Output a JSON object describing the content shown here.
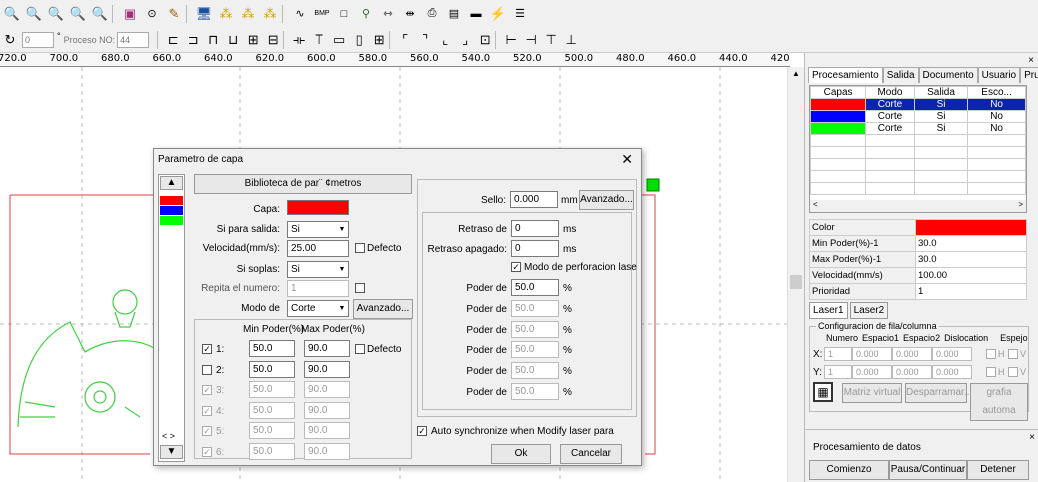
{
  "toolbar2": {
    "angle_value": "0",
    "degree_symbol": "°",
    "proceso_label": "Proceso NO:",
    "proceso_value": "44"
  },
  "ruler": {
    "ticks": [
      "720.0",
      "700.0",
      "680.0",
      "660.0",
      "640.0",
      "620.0",
      "600.0",
      "580.0",
      "560.0",
      "540.0",
      "520.0",
      "500.0",
      "480.0",
      "460.0",
      "440.0",
      "420.0"
    ]
  },
  "right_panel": {
    "tabs": [
      "Procesamiento",
      "Salida",
      "Documento",
      "Usuario",
      "Pru"
    ],
    "layer_headers": [
      "Capas",
      "Modo",
      "Salida",
      "Esco..."
    ],
    "layers": [
      {
        "color": "#ff0000",
        "mode": "Corte",
        "output": "Si",
        "skip": "No",
        "selected": true
      },
      {
        "color": "#0000ff",
        "mode": "Corte",
        "output": "Si",
        "skip": "No",
        "selected": false
      },
      {
        "color": "#00ff00",
        "mode": "Corte",
        "output": "Si",
        "skip": "No",
        "selected": false
      }
    ],
    "props": [
      {
        "label": "Color",
        "value": ""
      },
      {
        "label": "Min Poder(%)-1",
        "value": "30.0"
      },
      {
        "label": "Max Poder(%)-1",
        "value": "30.0"
      },
      {
        "label": "Velocidad(mm/s)",
        "value": "100.00"
      },
      {
        "label": "Prioridad",
        "value": "1"
      }
    ],
    "laser_tabs": [
      "Laser1",
      "Laser2"
    ],
    "grid_title": "Configuracion de fila/columna",
    "grid_headers": [
      "Numero",
      "Espacio1",
      "Espacio2",
      "Dislocation",
      "Espejo"
    ],
    "grid_x_label": "X:",
    "grid_y_label": "Y:",
    "grid_x": [
      "1",
      "0.000",
      "0.000",
      "0.000"
    ],
    "grid_y": [
      "1",
      "0.000",
      "0.000",
      "0.000"
    ],
    "mirror_h": "H",
    "mirror_v": "V",
    "matriz_btn": "Matriz virtual",
    "desparramar_btn": "Desparramar...",
    "grafia_btn": "grafia automa",
    "datos_title": "Procesamiento de datos",
    "comienzo_btn": "Comienzo",
    "pausa_btn": "Pausa/Continuar",
    "detener_btn": "Detener"
  },
  "dialog": {
    "title": "Parametro de capa",
    "library_btn": "Biblioteca de par¨ ¢metros",
    "capa_label": "Capa:",
    "capa_color": "#ff0000",
    "si_salida_label": "Si para salida:",
    "si_salida_value": "Si",
    "velocidad_label": "Velocidad(mm/s):",
    "velocidad_value": "25.00",
    "defecto_label": "Defecto",
    "soplas_label": "Si soplas:",
    "soplas_value": "Si",
    "repita_label": "Repita el numero:",
    "repita_value": "1",
    "modo_label": "Modo de",
    "modo_value": "Corte",
    "avanzado_btn": "Avanzado...",
    "min_poder_label": "Min Poder(%)",
    "max_poder_label": "Max Poder(%)",
    "power_rows": [
      {
        "n": "1:",
        "min": "50.0",
        "max": "90.0",
        "checked": true,
        "enabled": true
      },
      {
        "n": "2:",
        "min": "50.0",
        "max": "90.0",
        "checked": false,
        "enabled": true
      },
      {
        "n": "3:",
        "min": "50.0",
        "max": "90.0",
        "checked": true,
        "enabled": false
      },
      {
        "n": "4:",
        "min": "50.0",
        "max": "90.0",
        "checked": true,
        "enabled": false
      },
      {
        "n": "5:",
        "min": "50.0",
        "max": "90.0",
        "checked": true,
        "enabled": false
      },
      {
        "n": "6:",
        "min": "50.0",
        "max": "90.0",
        "checked": true,
        "enabled": false
      }
    ],
    "sello_label": "Sello:",
    "sello_value": "0.000",
    "mm_unit": "mm",
    "avanzado2_btn": "Avanzado...",
    "retraso_de_label": "Retraso de",
    "retraso_de_value": "0",
    "retraso_apagado_label": "Retraso apagado:",
    "retraso_apagado_value": "0",
    "ms_unit": "ms",
    "perforacion_label": "Modo de perforacion lase",
    "poder_label": "Poder de",
    "poder_rows": [
      "50.0",
      "50.0",
      "50.0",
      "50.0",
      "50.0",
      "50.0"
    ],
    "pct_unit": "%",
    "auto_sync_label": "Auto synchronize when Modify laser para",
    "ok_btn": "Ok",
    "cancel_btn": "Cancelar",
    "layer_colors": [
      "#ff0000",
      "#0000ff",
      "#00ff00"
    ]
  }
}
